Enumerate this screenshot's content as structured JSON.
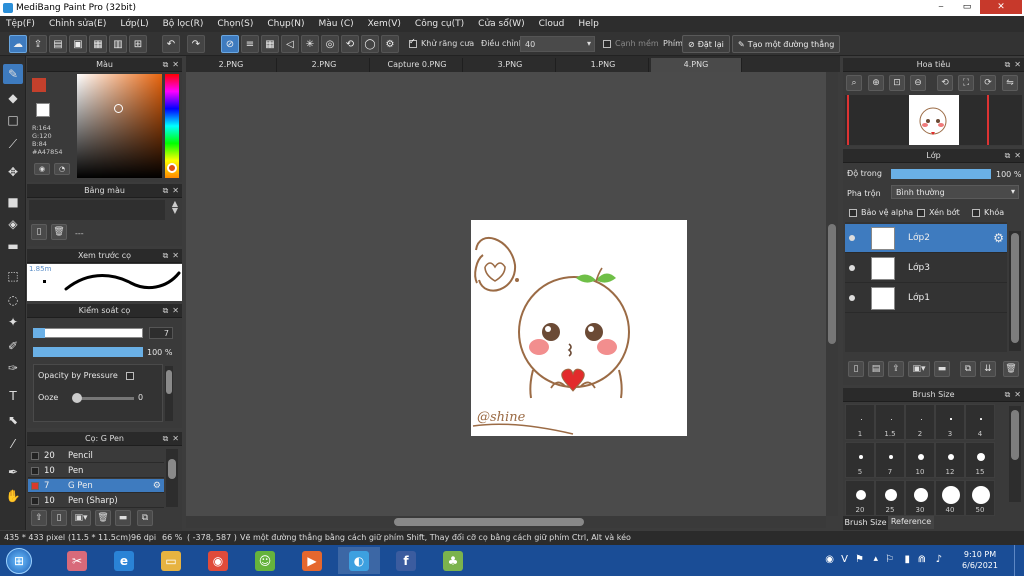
{
  "window": {
    "title": "MediBang Paint Pro (32bit)",
    "controls": [
      "⎯",
      "▭",
      "✕"
    ]
  },
  "menu": [
    "Tệp(F)",
    "Chỉnh sửa(E)",
    "Lớp(L)",
    "Bộ lọc(R)",
    "Chọn(S)",
    "Chụp(N)",
    "Màu (C)",
    "Xem(V)",
    "Công cụ(T)",
    "Cửa sổ(W)",
    "Cloud",
    "Help"
  ],
  "toolbar": {
    "antialias_label": "Khử răng cưa",
    "antialias_checked": true,
    "adjust_label": "Điều chỉnh",
    "adjust_value": "40",
    "snap_label": "Cạnh mềm",
    "snap_checked": false,
    "brush_label": "Phím",
    "reset_label": "Đặt lại",
    "straight_line_label": "Tạo một đường thẳng"
  },
  "color_panel": {
    "title": "Màu",
    "r": "R:164",
    "g": "G:120",
    "b": "B:84",
    "hex": "#A47854",
    "foreground": "#c4402c",
    "background": "#ffffff"
  },
  "palette_panel": {
    "title": "Bảng màu",
    "empty_label": "---"
  },
  "brush_preview_panel": {
    "title": "Xem trước cọ",
    "size_label": "1.85m"
  },
  "brush_control_panel": {
    "title": "Kiểm soát cọ",
    "size_value": "7",
    "size_fraction": 0.06,
    "opacity_value": "100 %",
    "opacity_fraction": 1.0,
    "opacity_by_pressure_label": "Opacity by Pressure",
    "ooze_label": "Ooze",
    "ooze_value": "0"
  },
  "brush_list_panel": {
    "title": "Cọ: G Pen",
    "items": [
      {
        "size": "20",
        "name": "Pencil",
        "selected": false,
        "swatch": "#222222"
      },
      {
        "size": "10",
        "name": "Pen",
        "selected": false,
        "swatch": "#222222"
      },
      {
        "size": "7",
        "name": "G Pen",
        "selected": true,
        "swatch": "#d93a2a"
      },
      {
        "size": "10",
        "name": "Pen (Sharp)",
        "selected": false,
        "swatch": "#222222"
      }
    ]
  },
  "tabs": [
    {
      "label": "2.PNG",
      "active": false
    },
    {
      "label": "2.PNG",
      "active": false
    },
    {
      "label": "Capture 0.PNG",
      "active": false
    },
    {
      "label": "3.PNG",
      "active": false
    },
    {
      "label": "1.PNG",
      "active": false
    },
    {
      "label": "4.PNG",
      "active": true
    }
  ],
  "artwork": {
    "signature": "@shine"
  },
  "navigator_panel": {
    "title": "Hoa tiêu"
  },
  "layer_panel": {
    "title": "Lớp",
    "opacity_label": "Độ trong",
    "opacity_value": "100 %",
    "opacity_fraction": 1.0,
    "blend_label": "Pha trộn",
    "blend_value": "Bình thường",
    "protect_alpha_label": "Bảo vệ alpha",
    "clip_label": "Xén bớt",
    "lock_label": "Khóa",
    "layers": [
      {
        "name": "Lớp2",
        "selected": true
      },
      {
        "name": "Lớp3",
        "selected": false
      },
      {
        "name": "Lớp1",
        "selected": false
      }
    ]
  },
  "brush_size_panel": {
    "title": "Brush Size",
    "sizes": [
      "1",
      "1.5",
      "2",
      "3",
      "4",
      "5",
      "7",
      "10",
      "12",
      "15",
      "20",
      "25",
      "30",
      "40",
      "50"
    ],
    "tab_brush_size": "Brush Size",
    "tab_reference": "Reference"
  },
  "status": {
    "size": "435 * 433 pixel",
    "physical": "(11.5 * 11.5cm)",
    "dpi": "96 dpi",
    "zoom": "66 %",
    "coords": "( -378, 587 )",
    "hint": "Vẽ một đường thẳng bằng cách giữ phím Shift, Thay đổi cỡ cọ bằng cách giữ phím Ctrl, Alt và kéo"
  },
  "taskbar": {
    "time": "9:10 PM",
    "date": "6/6/2021",
    "apps": [
      {
        "name": "paint-app",
        "glyph": "✂",
        "color": "#d86a7a"
      },
      {
        "name": "ie",
        "glyph": "e",
        "color": "#2a83d6"
      },
      {
        "name": "explorer",
        "glyph": "▭",
        "color": "#e7b341"
      },
      {
        "name": "chrome",
        "glyph": "◉",
        "color": "#e04b3a"
      },
      {
        "name": "green-app",
        "glyph": "☺",
        "color": "#65b33c"
      },
      {
        "name": "media",
        "glyph": "▶",
        "color": "#e5672e"
      },
      {
        "name": "medibang",
        "glyph": "◐",
        "color": "#3da0e0"
      },
      {
        "name": "facebook",
        "glyph": "f",
        "color": "#3b5c9f"
      },
      {
        "name": "game",
        "glyph": "♣",
        "color": "#7bb34d"
      }
    ]
  }
}
